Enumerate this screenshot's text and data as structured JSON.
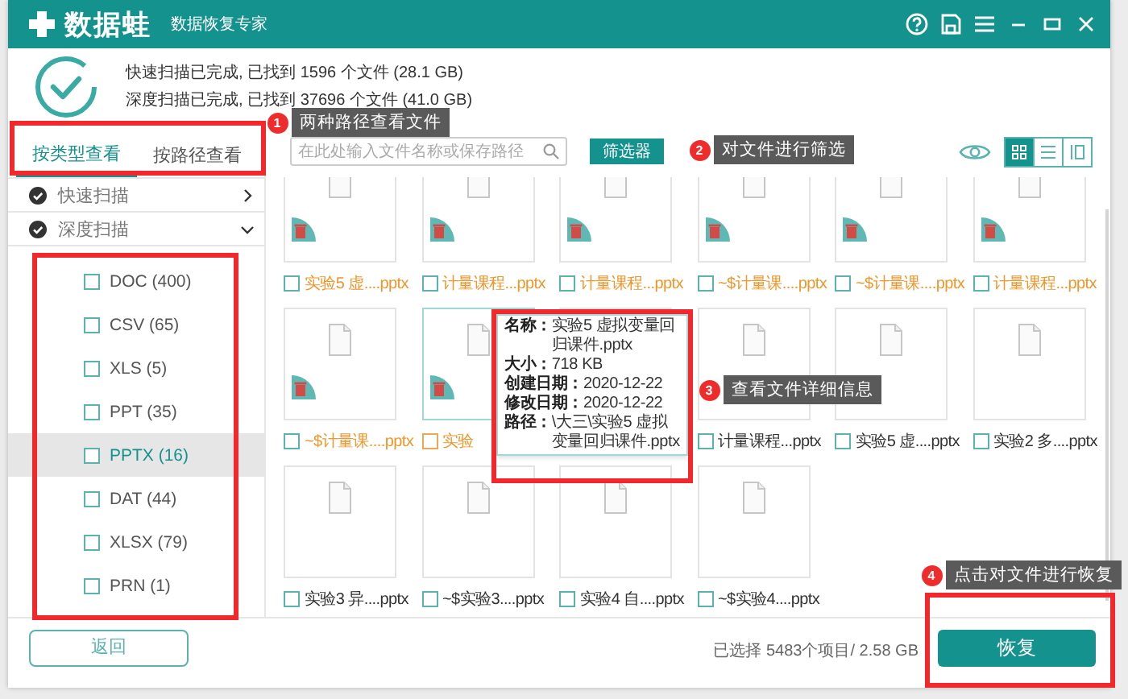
{
  "title_bar": {
    "logo": "数据蛙",
    "subtitle": "数据恢复专家"
  },
  "scan_summary": [
    {
      "text": "快速扫描已完成, 已找到 1596 个文件 (28.1 GB)"
    },
    {
      "text": "深度扫描已完成, 已找到 37696 个文件 (41.0 GB)"
    }
  ],
  "tabs": [
    {
      "label": "按类型查看",
      "selected": true
    },
    {
      "label": "按路径查看",
      "selected": false
    }
  ],
  "scans": [
    {
      "label": "快速扫描",
      "expanded": false
    },
    {
      "label": "深度扫描",
      "expanded": true,
      "children": [
        {
          "label": "DOC (400)",
          "checked": false,
          "selected": false
        },
        {
          "label": "CSV (65)",
          "checked": false,
          "selected": false
        },
        {
          "label": "XLS (5)",
          "checked": false,
          "selected": false
        },
        {
          "label": "PPT (35)",
          "checked": false,
          "selected": false
        },
        {
          "label": "PPTX (16)",
          "checked": false,
          "selected": true
        },
        {
          "label": "DAT (44)",
          "checked": false,
          "selected": false
        },
        {
          "label": "XLSX (79)",
          "checked": false,
          "selected": false
        },
        {
          "label": "PRN (1)",
          "checked": false,
          "selected": false
        }
      ]
    }
  ],
  "search": {
    "placeholder": "在此处输入文件名称或保存路径"
  },
  "filter_button": "筛选器",
  "view_modes": [
    {
      "kind": "grid",
      "selected": true
    },
    {
      "kind": "list",
      "selected": false
    },
    {
      "kind": "columns",
      "selected": false
    }
  ],
  "files": [
    {
      "kind": "file",
      "name": "实验5 虚....pptx",
      "deleted": true,
      "checked": false,
      "hovered": false
    },
    {
      "kind": "file",
      "name": "计量课程...pptx",
      "deleted": true,
      "checked": false,
      "hovered": false
    },
    {
      "kind": "file",
      "name": "计量课程...pptx",
      "deleted": true,
      "checked": false,
      "hovered": false
    },
    {
      "kind": "file",
      "name": "~$计量课....pptx",
      "deleted": true,
      "checked": false,
      "hovered": false
    },
    {
      "kind": "file",
      "name": "~$计量课....pptx",
      "deleted": true,
      "checked": false,
      "hovered": false
    },
    {
      "kind": "file",
      "name": "计量课程...pptx",
      "deleted": true,
      "checked": false,
      "hovered": false
    },
    {
      "kind": "file",
      "name": "~$计量课....pptx",
      "deleted": true,
      "checked": false,
      "hovered": false
    },
    {
      "kind": "file",
      "name": "实验",
      "deleted": true,
      "checked": false,
      "hovered": true
    },
    {
      "kind": "covered"
    },
    {
      "kind": "file",
      "name": "计量课程...pptx",
      "deleted": false,
      "checked": false,
      "hovered": false
    },
    {
      "kind": "file",
      "name": "实验5 虚....pptx",
      "deleted": false,
      "checked": false,
      "hovered": false
    },
    {
      "kind": "file",
      "name": "实验2 多....pptx",
      "deleted": false,
      "checked": false,
      "hovered": false
    },
    {
      "kind": "file",
      "name": "实验3 异....pptx",
      "deleted": false,
      "checked": false,
      "hovered": false
    },
    {
      "kind": "file",
      "name": "~$实验3....pptx",
      "deleted": false,
      "checked": false,
      "hovered": false
    },
    {
      "kind": "file",
      "name": "实验4 自....pptx",
      "deleted": false,
      "checked": false,
      "hovered": false
    },
    {
      "kind": "file",
      "name": "~$实验4....pptx",
      "deleted": false,
      "checked": false,
      "hovered": false
    }
  ],
  "tooltip": {
    "rows": [
      {
        "label": "名称：",
        "value": "实验5 虚拟变量回归课件.pptx"
      },
      {
        "label": "大小：",
        "value": "718 KB"
      },
      {
        "label": "创建日期：",
        "value": "2020-12-22"
      },
      {
        "label": "修改日期：",
        "value": "2020-12-22"
      },
      {
        "label": "路径：",
        "value": "\\大三\\实验5 虚拟变量回归课件.pptx"
      }
    ]
  },
  "bottom_bar": {
    "back_button": "返回",
    "selection": "已选择 5483个项目/ 2.58 GB",
    "recover_button": "恢复"
  },
  "annotations": [
    {
      "number": "1",
      "text": "两种路径查看文件"
    },
    {
      "number": "2",
      "text": "对文件进行筛选"
    },
    {
      "number": "3",
      "text": "查看文件详细信息"
    },
    {
      "number": "4",
      "text": "点击对文件进行恢复"
    }
  ]
}
